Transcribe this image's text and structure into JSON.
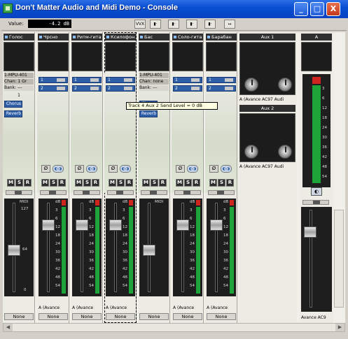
{
  "window": {
    "title": "Don't Matter Audio and Midi Demo - Console",
    "minimize": "_",
    "maximize": "□",
    "close": "X"
  },
  "toolbar": {
    "value_label": "Value:",
    "value": "-4.2 dB",
    "buttons": [
      "VVX",
      "▮·",
      "▮·",
      "▮·",
      "▮·"
    ]
  },
  "tooltip": "Track 4 Aux 2 Send Level = 0 dB",
  "strips": [
    {
      "name": "Голос",
      "line1": "1-MPU-401",
      "line2": "Chan: 1 Gr",
      "line3": "Bank: ---",
      "line4": "1",
      "fx1": "Chorus",
      "fx2": "Reverb",
      "output": "MIDI",
      "scale_top": "127",
      "scale_mid": "64",
      "scale_bot": "0",
      "none": "None",
      "kind": "midi"
    },
    {
      "name": "Чрсно",
      "line1": "",
      "send1": "1",
      "send2": "2",
      "output": "A (Avance",
      "none": "None",
      "kind": "audio"
    },
    {
      "name": "Ритм-гита",
      "line1": "",
      "send1": "1",
      "send2": "2",
      "output": "A (Avance",
      "none": "None",
      "kind": "audio"
    },
    {
      "name": "Ксилофон",
      "line1": "",
      "send1": "1",
      "send2": "2",
      "output": "A (Avance",
      "none": "None",
      "kind": "audio"
    },
    {
      "name": "Бас",
      "line1": "1-MPU-401",
      "line2": "Chan: none",
      "line3": "Bank: ---",
      "fx1": "Chorus",
      "fx2": "Reverb",
      "output": "MIDI",
      "none": "None",
      "kind": "midi"
    },
    {
      "name": "Соло-гита",
      "line1": "",
      "send1": "1",
      "send2": "2",
      "output": "A (Avance",
      "none": "None",
      "kind": "audio"
    },
    {
      "name": "Барабан",
      "line1": "",
      "send1": "1",
      "send2": "2",
      "output": "A (Avance",
      "none": "None",
      "kind": "audio"
    }
  ],
  "msr": [
    "M",
    "S",
    "R"
  ],
  "meter_scale": [
    "dB",
    "3",
    "6",
    "12",
    "18",
    "24",
    "30",
    "36",
    "42",
    "48",
    "54"
  ],
  "aux": [
    {
      "name": "Aux 1",
      "output": "A (Avance AC97 Audi"
    },
    {
      "name": "Aux 2",
      "output": "A (Avance AC97 Audi"
    }
  ],
  "master": {
    "name": "A",
    "scale": [
      "3",
      "6",
      "12",
      "18",
      "24",
      "30",
      "36",
      "42",
      "48",
      "54"
    ],
    "output": "Avance AC9"
  },
  "phase_label": "Ø"
}
